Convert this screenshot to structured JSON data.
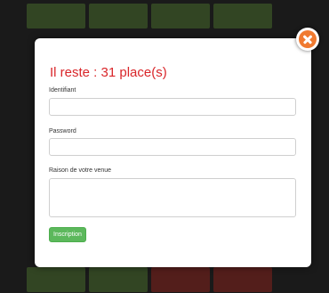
{
  "modal": {
    "title": "Il reste : 31 place(s)",
    "identifiant_label": "Identifiant",
    "identifiant_value": "",
    "password_label": "Password",
    "password_value": "",
    "reason_label": "Raison de votre venue",
    "reason_value": "",
    "submit_label": "Inscription"
  },
  "colors": {
    "title": "#d9262a",
    "submit": "#5cb85c",
    "close": "#f07a30"
  }
}
